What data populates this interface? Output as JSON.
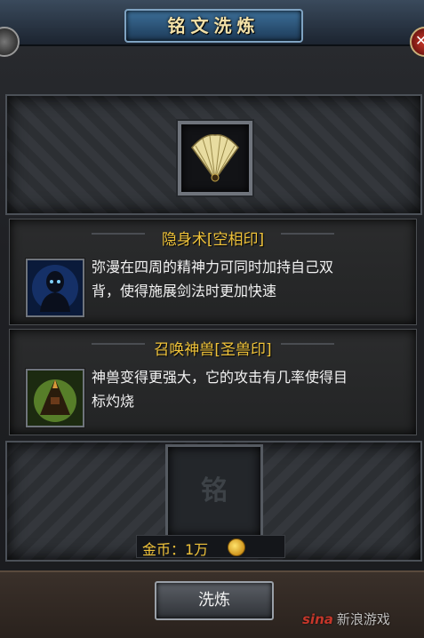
{
  "window": {
    "title": "铭文洗炼"
  },
  "equipment_slot": {
    "icon": "fan-icon"
  },
  "runes": [
    {
      "name": "隐身术[空相印]",
      "icon": "stealth-figure-icon",
      "description_lines": [
        "弥漫在四周的精神力可同时加持自己双",
        "背，使得施展剑法时更加快速"
      ]
    },
    {
      "name": "召唤神兽[圣兽印]",
      "icon": "summon-beast-icon",
      "description_lines": [
        "神兽变得更强大，它的攻击有几率使得目",
        "标灼烧"
      ]
    }
  ],
  "seal_slot": {
    "glyph": "铭"
  },
  "gold": {
    "label": "金币：1万",
    "icon": "gold-coin-icon"
  },
  "actions": {
    "refine_label": "洗炼"
  },
  "watermark": {
    "logo": "sina",
    "text": "新浪游戏"
  },
  "colors": {
    "title_text": "#f3e1a8",
    "rune_name": "#f0c33a",
    "gold_text": "#f0c33a",
    "close_red": "#d23a2c"
  }
}
